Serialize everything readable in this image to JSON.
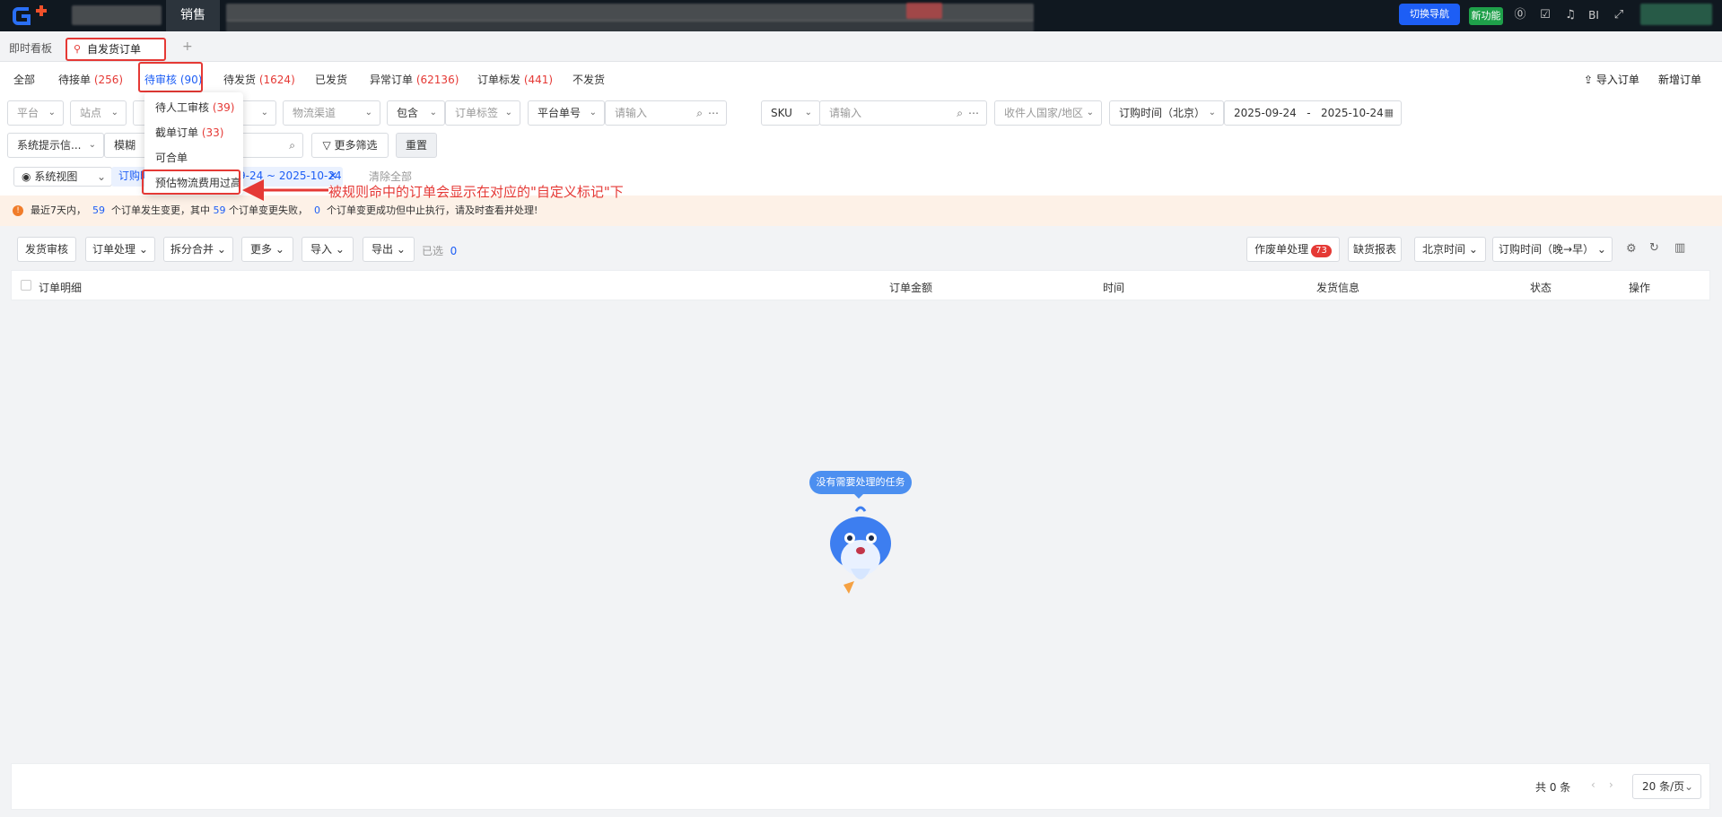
{
  "topbar": {
    "module_active": "销售",
    "switch_nav": "切换导航",
    "new_feature": "新功能",
    "bi_label": "BI"
  },
  "tabs": {
    "dashboard": "即时看板",
    "active": "自发货订单",
    "add": "+"
  },
  "status_tabs": [
    {
      "label": "全部",
      "count": ""
    },
    {
      "label": "待接单",
      "count": "(256)"
    },
    {
      "label": "待审核",
      "count": "(90)"
    },
    {
      "label": "待发货",
      "count": "(1624)"
    },
    {
      "label": "已发货",
      "count": ""
    },
    {
      "label": "异常订单",
      "count": "(62136)"
    },
    {
      "label": "订单标发",
      "count": "(441)"
    },
    {
      "label": "不发货",
      "count": ""
    }
  ],
  "actions": {
    "import_order": "导入订单",
    "new_order": "新增订单"
  },
  "filters": {
    "platform": "平台",
    "site": "站点",
    "logistics": "物流渠道",
    "contains": "包含",
    "order_tag": "订单标签",
    "platform_no": "平台单号",
    "input_placeholder": "请输入",
    "sku": "SKU",
    "sku_placeholder": "请输入",
    "receiver_country": "收件人国家/地区",
    "order_time": "订购时间（北京）",
    "date_start": "2025-09-24",
    "date_sep": "-",
    "date_end": "2025-10-24",
    "system_tip": "系统提示信...",
    "fuzzy": "模糊",
    "more_filter": "更多筛选",
    "reset": "重置",
    "system_view": "系统视图",
    "chip_prefix": "订购时",
    "chip_range": "9-24 ~ 2025-10-24",
    "clear_all": "清除全部"
  },
  "dropdown": {
    "items": [
      {
        "label": "待人工审核",
        "count": "(39)"
      },
      {
        "label": "截单订单",
        "count": "(33)"
      },
      {
        "label": "可合单",
        "count": ""
      },
      {
        "label": "预估物流费用过高",
        "count": ""
      }
    ]
  },
  "annotation": "被规则命中的订单会显示在对应的\"自定义标记\"下",
  "alert": {
    "p1": "最近7天内，",
    "n1": "59",
    "p2": "个订单发生变更，其中",
    "n2": "59",
    "p3": "个订单变更失败，",
    "n3": "0",
    "p4": "个订单变更成功但中止执行，请及时查看并处理!"
  },
  "toolbar": {
    "ship_review": "发货审核",
    "order_process": "订单处理",
    "split_merge": "拆分合并",
    "more": "更多",
    "import": "导入",
    "export": "导出",
    "selected": "已选",
    "selected_count": "0",
    "void_process": "作废单处理",
    "void_count": "73",
    "stock_report": "缺货报表",
    "beijing_time": "北京时间",
    "sort": "订购时间（晚→早）"
  },
  "table": {
    "headers": [
      "订单明细",
      "订单金额",
      "时间",
      "发货信息",
      "状态",
      "操作"
    ]
  },
  "empty": {
    "message": "没有需要处理的任务"
  },
  "pagination": {
    "total": "共 0 条",
    "prev": "‹",
    "next": "›",
    "page_size": "20 条/页"
  }
}
